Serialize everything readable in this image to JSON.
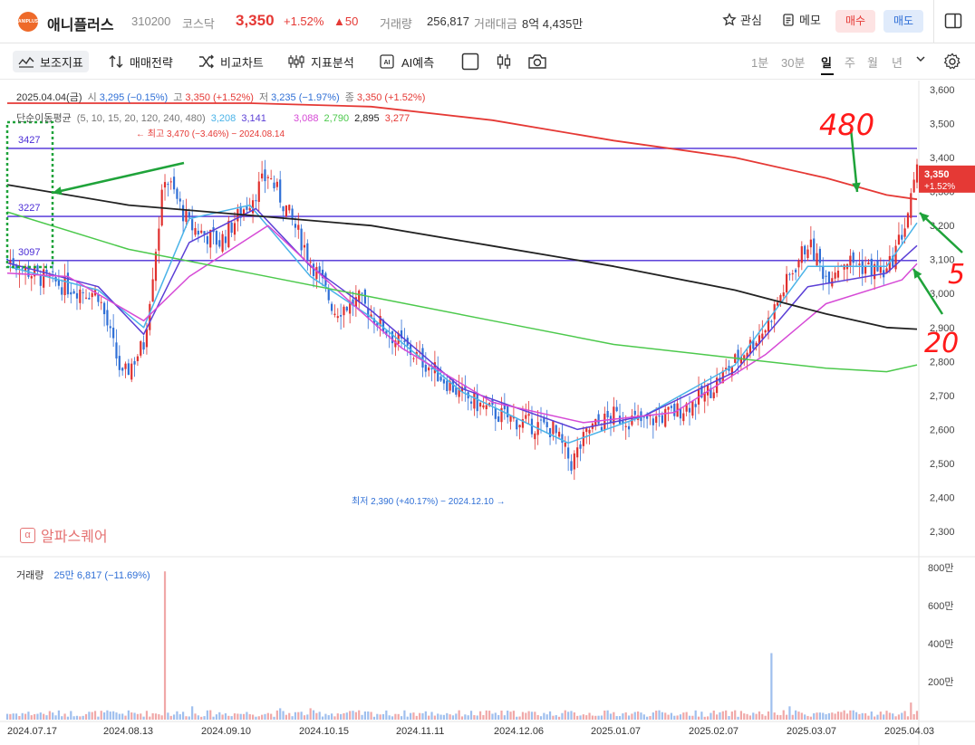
{
  "header": {
    "logo_text": "ANIPLUS",
    "name": "애니플러스",
    "code": "310200",
    "market": "코스닥",
    "price": "3,350",
    "change_rate": "+1.52%",
    "change_value": "▲50",
    "volume_label": "거래량",
    "volume": "256,817",
    "amount_label": "거래대금",
    "amount": "8억 4,435만",
    "watch_label": "관심",
    "memo_label": "메모",
    "buy_label": "매수",
    "sell_label": "매도"
  },
  "toolbar": {
    "indicators": "보조지표",
    "strategy": "매매전략",
    "compare": "비교차트",
    "analysis": "지표분석",
    "ai": "AI예측",
    "timeframes": [
      "1분",
      "30분",
      "일",
      "주",
      "월",
      "년"
    ],
    "selected_timeframe": "일"
  },
  "legend": {
    "date": "2025.04.04(금)",
    "open_label": "시",
    "open": "3,295 (−0.15%)",
    "high_label": "고",
    "high": "3,350 (+1.52%)",
    "low_label": "저",
    "low": "3,235 (−1.97%)",
    "close_label": "종",
    "close": "3,350 (+1.52%)",
    "ma_label": "단순이동평균",
    "ma_periods": "(5, 10, 15, 20, 120, 240, 480)",
    "ma_values": [
      {
        "value": "3,208",
        "color": "#4ab3e8"
      },
      {
        "value": "3,141",
        "color": "#5b3fd6"
      },
      {
        "value": "3,088",
        "color": "#d64ad6"
      },
      {
        "value": "2,790",
        "color": "#4cc94c"
      },
      {
        "value": "2,895",
        "color": "#222222"
      },
      {
        "value": "3,277",
        "color": "#e53935"
      }
    ]
  },
  "annotations": {
    "high_marker": "← 최고 3,470 (−3.46%) − 2024.08.14",
    "low_marker": "최저 2,390 (+40.17%) − 2024.12.10 →",
    "hlines": [
      "3427",
      "3227",
      "3097"
    ],
    "hand_480": "480",
    "hand_5": "5",
    "hand_20": "20"
  },
  "watermark": "알파스퀘어",
  "volume_panel": {
    "label": "거래량",
    "value": "25만 6,817 (−11.69%)"
  },
  "chart_data": {
    "type": "candlestick",
    "price_axis": {
      "ticks": [
        3600,
        3500,
        3400,
        3300,
        3200,
        3100,
        3000,
        2900,
        2800,
        2700,
        2600,
        2500,
        2400,
        2300
      ],
      "ylim": [
        2300,
        3600
      ]
    },
    "volume_axis": {
      "ticks": [
        "800만",
        "600만",
        "400만",
        "200만"
      ],
      "ylim": [
        0,
        8000000
      ]
    },
    "x_labels": [
      "2024.07.17",
      "2024.08.13",
      "2024.09.10",
      "2024.10.15",
      "2024.11.11",
      "2024.12.06",
      "2025.01.07",
      "2025.02.07",
      "2025.03.07",
      "2025.04.03"
    ],
    "current_price_tag": {
      "price": "3,350",
      "rate": "+1.52%"
    },
    "horizontal_lines": [
      3427,
      3227,
      3097
    ],
    "close_path": [
      [
        0,
        3100
      ],
      [
        10,
        3050
      ],
      [
        20,
        3020
      ],
      [
        30,
        3000
      ],
      [
        38,
        2750
      ],
      [
        45,
        2850
      ],
      [
        52,
        3350
      ],
      [
        60,
        3200
      ],
      [
        70,
        3150
      ],
      [
        78,
        3250
      ],
      [
        86,
        3350
      ],
      [
        92,
        3250
      ],
      [
        100,
        3100
      ],
      [
        108,
        2950
      ],
      [
        116,
        2980
      ],
      [
        124,
        2900
      ],
      [
        130,
        2850
      ],
      [
        140,
        2780
      ],
      [
        150,
        2700
      ],
      [
        160,
        2650
      ],
      [
        170,
        2620
      ],
      [
        180,
        2600
      ],
      [
        186,
        2500
      ],
      [
        192,
        2600
      ],
      [
        200,
        2640
      ],
      [
        210,
        2620
      ],
      [
        220,
        2650
      ],
      [
        230,
        2700
      ],
      [
        240,
        2800
      ],
      [
        250,
        2900
      ],
      [
        258,
        3050
      ],
      [
        264,
        3150
      ],
      [
        270,
        3050
      ],
      [
        276,
        3100
      ],
      [
        282,
        3080
      ],
      [
        290,
        3060
      ],
      [
        296,
        3200
      ],
      [
        300,
        3350
      ]
    ],
    "ma": [
      {
        "name": "5",
        "color": "#4ab3e8",
        "points": [
          [
            0,
            3080
          ],
          [
            30,
            3010
          ],
          [
            45,
            2900
          ],
          [
            60,
            3220
          ],
          [
            80,
            3260
          ],
          [
            100,
            3050
          ],
          [
            120,
            2930
          ],
          [
            150,
            2710
          ],
          [
            185,
            2560
          ],
          [
            210,
            2640
          ],
          [
            240,
            2790
          ],
          [
            264,
            3080
          ],
          [
            290,
            3080
          ],
          [
            300,
            3208
          ]
        ]
      },
      {
        "name": "10",
        "color": "#5b3fd6",
        "points": [
          [
            0,
            3090
          ],
          [
            30,
            3020
          ],
          [
            45,
            2880
          ],
          [
            60,
            3150
          ],
          [
            82,
            3250
          ],
          [
            100,
            3080
          ],
          [
            120,
            2950
          ],
          [
            150,
            2720
          ],
          [
            188,
            2600
          ],
          [
            210,
            2640
          ],
          [
            240,
            2770
          ],
          [
            264,
            3020
          ],
          [
            290,
            3060
          ],
          [
            300,
            3141
          ]
        ]
      },
      {
        "name": "20",
        "color": "#d64ad6",
        "points": [
          [
            0,
            3060
          ],
          [
            20,
            3050
          ],
          [
            45,
            2920
          ],
          [
            60,
            3050
          ],
          [
            86,
            3200
          ],
          [
            110,
            3000
          ],
          [
            130,
            2840
          ],
          [
            160,
            2680
          ],
          [
            190,
            2620
          ],
          [
            220,
            2650
          ],
          [
            250,
            2820
          ],
          [
            270,
            2970
          ],
          [
            295,
            3040
          ],
          [
            300,
            3088
          ]
        ]
      },
      {
        "name": "120",
        "color": "#4cc94c",
        "points": [
          [
            0,
            3240
          ],
          [
            40,
            3130
          ],
          [
            80,
            3060
          ],
          [
            120,
            2990
          ],
          [
            160,
            2920
          ],
          [
            200,
            2850
          ],
          [
            240,
            2810
          ],
          [
            270,
            2780
          ],
          [
            290,
            2770
          ],
          [
            300,
            2790
          ]
        ]
      },
      {
        "name": "240",
        "color": "#222222",
        "points": [
          [
            0,
            3320
          ],
          [
            40,
            3260
          ],
          [
            80,
            3230
          ],
          [
            120,
            3200
          ],
          [
            160,
            3140
          ],
          [
            200,
            3080
          ],
          [
            240,
            3010
          ],
          [
            270,
            2940
          ],
          [
            290,
            2900
          ],
          [
            300,
            2895
          ]
        ]
      },
      {
        "name": "480",
        "color": "#e53935",
        "points": [
          [
            0,
            3560
          ],
          [
            40,
            3560
          ],
          [
            80,
            3560
          ],
          [
            120,
            3550
          ],
          [
            160,
            3510
          ],
          [
            200,
            3450
          ],
          [
            240,
            3400
          ],
          [
            270,
            3340
          ],
          [
            290,
            3290
          ],
          [
            300,
            3277
          ]
        ]
      }
    ]
  }
}
